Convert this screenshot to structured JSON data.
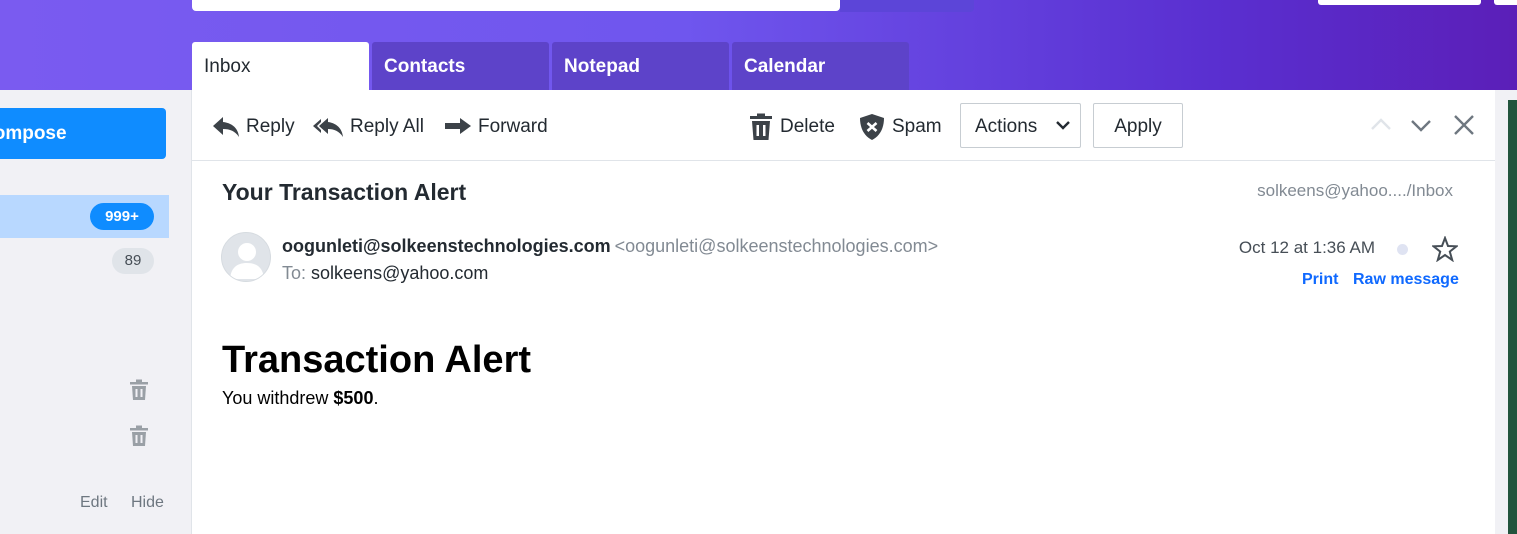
{
  "tabs": [
    {
      "label": "Inbox",
      "active": true
    },
    {
      "label": "Contacts",
      "active": false
    },
    {
      "label": "Notepad",
      "active": false
    },
    {
      "label": "Calendar",
      "active": false
    }
  ],
  "sidebar": {
    "compose_label": "Compose",
    "inbox_badge": "999+",
    "second_badge": "89",
    "edit_label": "Edit",
    "hide_label": "Hide"
  },
  "toolbar": {
    "reply": "Reply",
    "reply_all": "Reply All",
    "forward": "Forward",
    "delete": "Delete",
    "spam": "Spam",
    "actions_selected": "Actions",
    "apply": "Apply"
  },
  "message": {
    "subject": "Your Transaction Alert",
    "folder_path": "solkeens@yahoo..../Inbox",
    "from_name": "oogunleti@solkeenstechnologies.com",
    "from_address": "<oogunleti@solkeenstechnologies.com>",
    "to_label": "To:",
    "to_address": "solkeens@yahoo.com",
    "date": "Oct 12 at 1:36 AM",
    "print_label": "Print",
    "raw_label": "Raw message",
    "body_heading": "Transaction Alert",
    "body_text_prefix": "You withdrew ",
    "body_amount": "$500",
    "body_text_suffix": "."
  },
  "colors": {
    "accent": "#0f8cff",
    "header_start": "#7a5bf0",
    "header_end": "#5b1fb8",
    "link": "#0f69ff"
  }
}
